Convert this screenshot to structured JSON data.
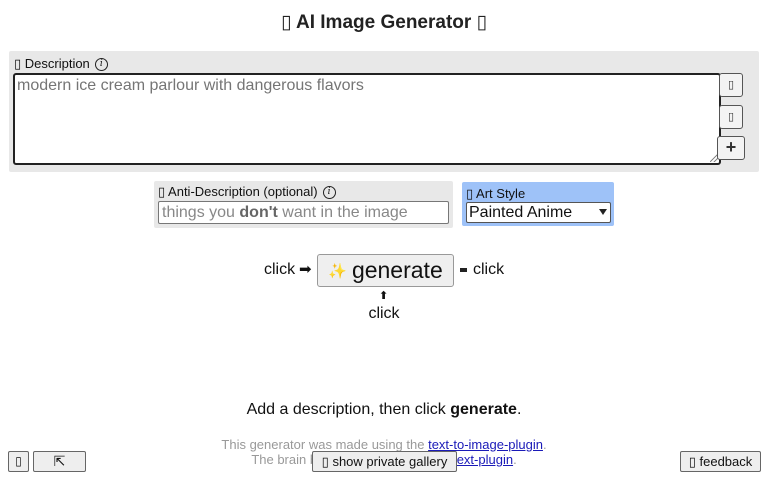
{
  "header": {
    "title": "▯ AI Image Generator ▯"
  },
  "description": {
    "label": "▯ Description",
    "info_icon": "ⓘ",
    "placeholder": "modern ice cream parlour with dangerous flavors",
    "side_buttons": [
      "▯",
      "▯",
      "+"
    ]
  },
  "anti_description": {
    "label": "▯ Anti-Description (optional)",
    "info_icon": "ⓘ",
    "placeholder_pre": "things you ",
    "placeholder_bold": "don't",
    "placeholder_post": " want in the image"
  },
  "art_style": {
    "label": "▯ Art Style",
    "selected": "Painted Anime"
  },
  "generate": {
    "click_left": "click",
    "arrow_right": "➡",
    "sparkle_icon": "✨",
    "button_label": "generate",
    "click_right": "click",
    "arrow_up": "⬆",
    "click_below": "click"
  },
  "hint": {
    "pre": "Add a description, then click ",
    "bold": "generate",
    "post": "."
  },
  "footer": {
    "line1_pre": "This generator was made using the ",
    "line1_link": "text-to-image-plugin",
    "line1_post": ".",
    "line2_pre": "The brain b",
    "line2_link": "text-plugin",
    "line2_post": ".",
    "gallery_button": "▯ show private gallery",
    "feedback_button": "▯ feedback",
    "corner_left_1": "▯",
    "corner_left_2": "⇱"
  },
  "colors": {
    "panel_gray": "#e8e8e8",
    "style_panel_blue": "#9ec2f8",
    "link_blue": "#1a1ab8"
  }
}
